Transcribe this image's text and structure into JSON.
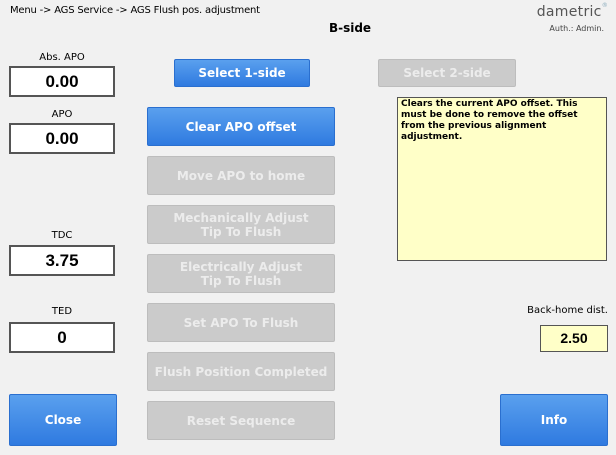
{
  "header": {
    "breadcrumb": "Menu -> AGS Service -> AGS Flush pos. adjustment",
    "logo_text": "dametric",
    "logo_mark": "®",
    "auth": "Auth.: Admin.",
    "side": "B-side"
  },
  "readouts": {
    "abs_apo": {
      "label": "Abs. APO",
      "value": "0.00"
    },
    "apo": {
      "label": "APO",
      "value": "0.00"
    },
    "tdc": {
      "label": "TDC",
      "value": "3.75"
    },
    "ted": {
      "label": "TED",
      "value": "0"
    }
  },
  "buttons": {
    "select_1": "Select 1-side",
    "select_2": "Select 2-side",
    "clear_apo": "Clear APO offset",
    "move_home": "Move APO to home",
    "mech_adjust": "Mechanically Adjust\nTip To Flush",
    "elec_adjust": "Electrically Adjust\nTip To Flush",
    "set_flush": "Set APO To Flush",
    "flush_completed": "Flush Position Completed",
    "reset": "Reset Sequence",
    "close": "Close",
    "info": "Info"
  },
  "info_text": "Clears the current APO offset. This must be done to remove the offset from the previous alignment adjustment.",
  "back_home": {
    "label": "Back-home dist.",
    "value": "2.50"
  },
  "colors": {
    "active_button": "#3e8ae6",
    "disabled_button": "#cbcbcb",
    "info_background": "#ffffc8"
  }
}
